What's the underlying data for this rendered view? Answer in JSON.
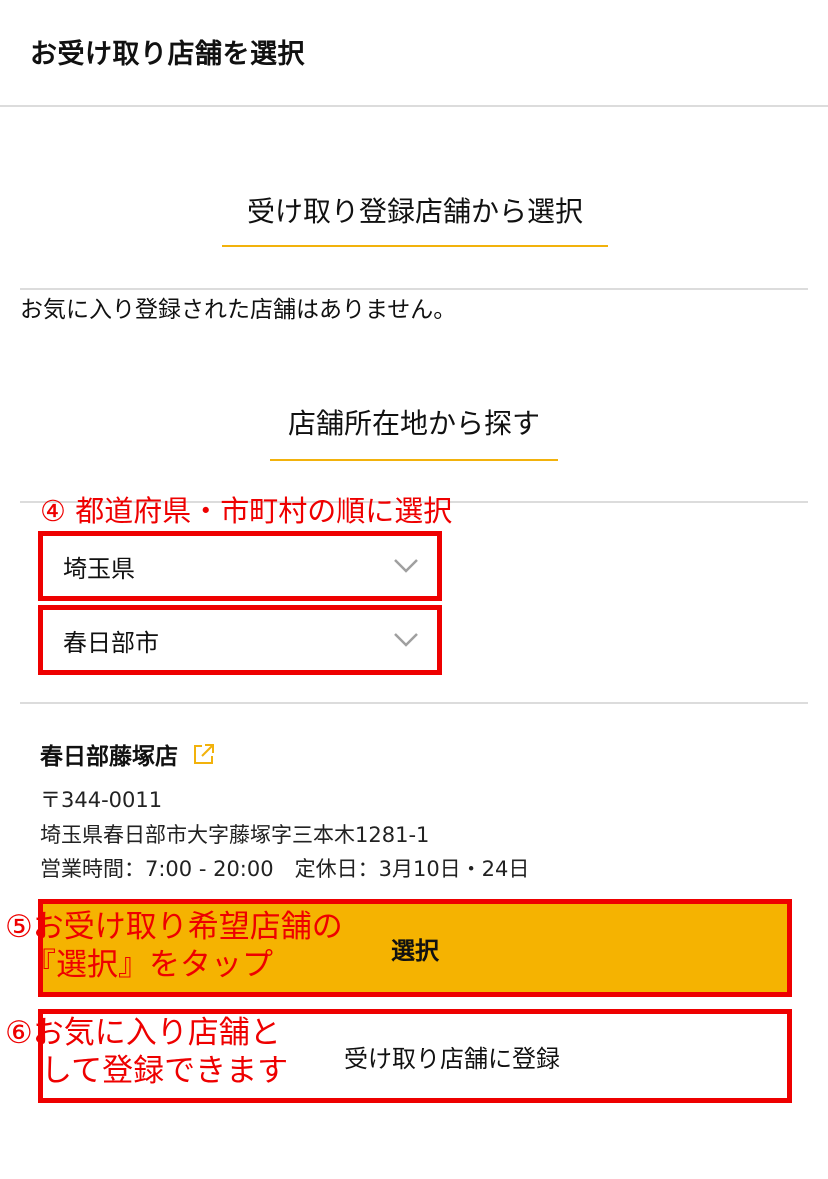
{
  "header": {
    "title": "お受け取り店舗を選択"
  },
  "registered_section": {
    "title": "受け取り登録店舗から選択",
    "empty_message": "お気に入り登録された店舗はありません。"
  },
  "location_section": {
    "title": "店舗所在地から探す",
    "prefecture_value": "埼玉県",
    "city_value": "春日部市"
  },
  "store": {
    "name": "春日部藤塚店",
    "postal": "〒344-0011",
    "address": "埼玉県春日部市大字藤塚字三本木1281-1",
    "hours": "営業時間：7:00 - 20:00　定休日：3月10日・24日",
    "select_label": "選択",
    "register_label": "受け取り店舗に登録"
  },
  "annotations": {
    "step4": "④ 都道府県・市町村の順に選択",
    "step5_line1": "⑤お受け取り希望店舗の",
    "step5_line2": "『選択』をタップ",
    "step6_line1": "⑥お気に入り店舗と",
    "step6_line2": "して登録できます"
  },
  "colors": {
    "accent": "#f5b301",
    "annotation": "#ee0000",
    "divider": "#dcdcdc"
  },
  "icons": {
    "dropdown": "chevron-down-icon",
    "external": "external-link-icon"
  }
}
